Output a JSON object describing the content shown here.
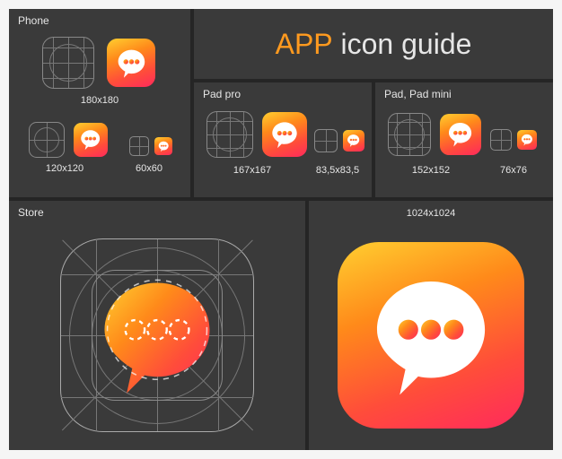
{
  "title": {
    "bold": "APP",
    "rest": " icon guide"
  },
  "sections": {
    "phone": {
      "label": "Phone",
      "sizes": {
        "s180": "180x180",
        "s120": "120x120",
        "s60": "60x60"
      }
    },
    "padpro": {
      "label": "Pad pro",
      "sizes": {
        "s167": "167x167",
        "s83": "83,5x83,5"
      }
    },
    "padmini": {
      "label": "Pad, Pad mini",
      "sizes": {
        "s152": "152x152",
        "s76": "76x76"
      }
    },
    "store": {
      "label": "Store"
    },
    "render": {
      "size": "1024x1024"
    }
  },
  "colors": {
    "panel": "#3a3a3a",
    "bg": "#252525",
    "text": "#e6e6e6",
    "accent": "#ff9a1f",
    "gradient_stops": [
      "#ffcf30",
      "#ff8a1a",
      "#ff4d3a",
      "#ff2a5c"
    ]
  }
}
